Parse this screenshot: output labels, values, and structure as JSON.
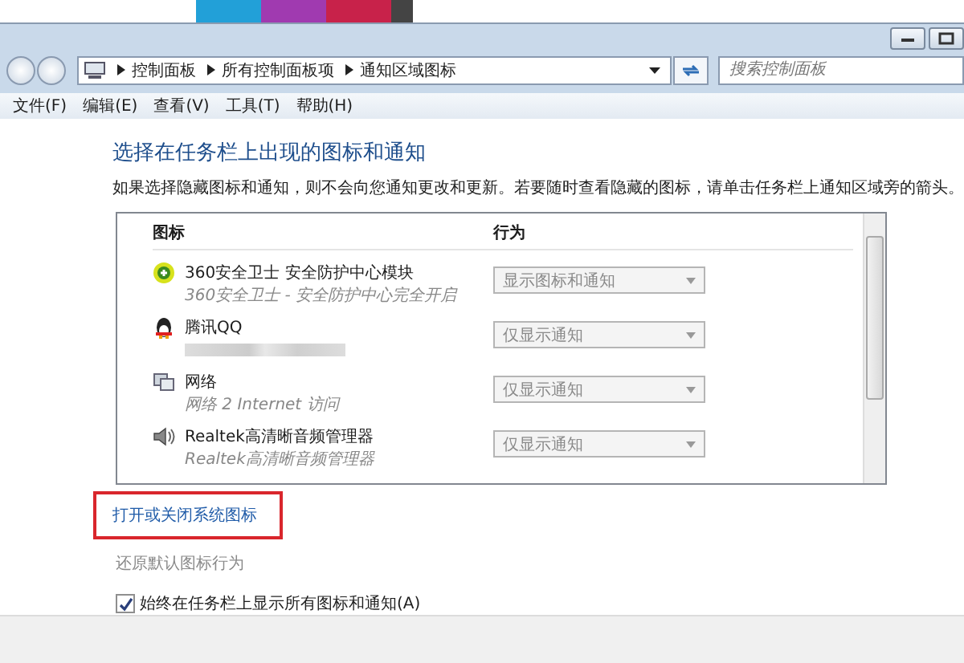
{
  "address_bar": {
    "breadcrumbs": [
      "控制面板",
      "所有控制面板项",
      "通知区域图标"
    ]
  },
  "search": {
    "placeholder": "搜索控制面板"
  },
  "menu": [
    "文件(F)",
    "编辑(E)",
    "查看(V)",
    "工具(T)",
    "帮助(H)"
  ],
  "heading": "选择在任务栏上出现的图标和通知",
  "description": "如果选择隐藏图标和通知，则不会向您通知更改和更新。若要随时查看隐藏的图标，请单击任务栏上通知区域旁的箭头。",
  "table": {
    "columns": [
      "图标",
      "行为"
    ],
    "rows": [
      {
        "kind": "shield",
        "name": "360安全卫士 安全防护中心模块",
        "subtitle": "360安全卫士 - 安全防护中心完全开启",
        "behavior": "显示图标和通知",
        "disabled": true
      },
      {
        "kind": "penguin",
        "name": "腾讯QQ",
        "blurred": true,
        "behavior": "仅显示通知",
        "disabled": true
      },
      {
        "kind": "network",
        "name": "网络",
        "subtitle": "网络 2 Internet 访问",
        "behavior": "仅显示通知",
        "disabled": true
      },
      {
        "kind": "speaker",
        "name": "Realtek高清晰音频管理器",
        "subtitle": "Realtek高清晰音频管理器",
        "behavior": "仅显示通知",
        "disabled": true
      }
    ]
  },
  "links": [
    {
      "label": "打开或关闭系统图标",
      "disabled": false,
      "highlighted": true
    },
    {
      "label": "还原默认图标行为",
      "disabled": true,
      "highlighted": false
    }
  ],
  "always_show": {
    "label": "始终在任务栏上显示所有图标和通知(A)",
    "checked": true
  }
}
